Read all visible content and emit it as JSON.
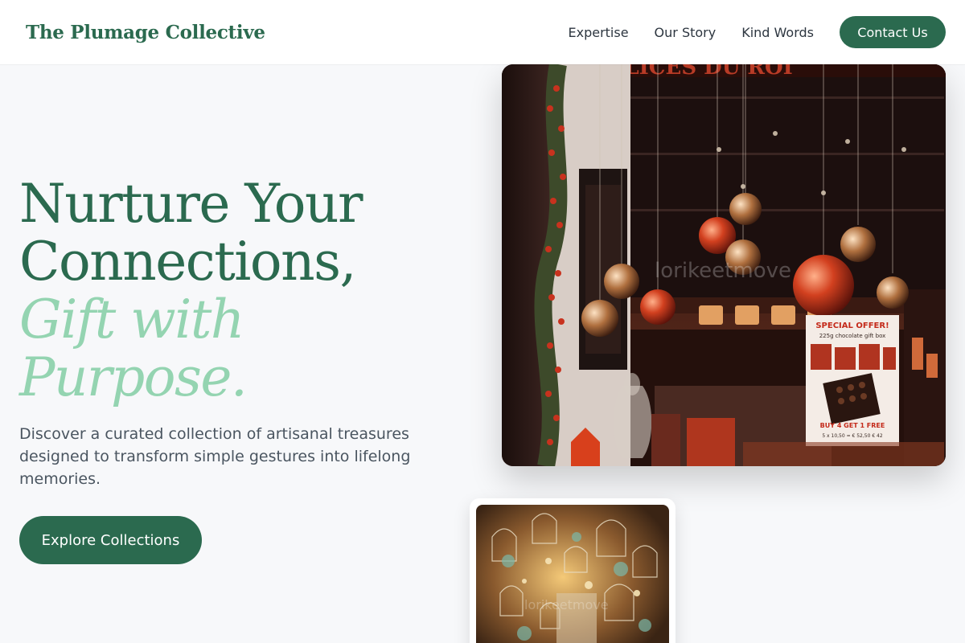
{
  "header": {
    "brand": "The Plumage Collective",
    "nav": [
      {
        "label": "Expertise"
      },
      {
        "label": "Our Story"
      },
      {
        "label": "Kind Words"
      }
    ],
    "cta_label": "Contact Us"
  },
  "hero": {
    "title_line1": "Nurture Your",
    "title_line2": "Connections,",
    "accent_line1": "Gift with",
    "accent_line2": "Purpose.",
    "description": "Discover a curated collection of artisanal treasures designed to transform simple gestures into lifelong memories.",
    "button_label": "Explore Collections"
  },
  "images": {
    "main": {
      "sign_text": "DÉLICES DU ROI",
      "watermark": "lorikeetmove",
      "poster_heading": "SPECIAL OFFER!",
      "poster_sub": "225g chocolate gift box",
      "poster_offer": "BUY 4 GET 1 FREE",
      "poster_price": "5 x 10,50 = € 52,50  € 42"
    },
    "secondary": {
      "watermark": "lorikeetmove"
    }
  },
  "colors": {
    "brand_green": "#2b6a4f",
    "accent_mint": "#94d4b1",
    "background": "#f7f8fa"
  }
}
